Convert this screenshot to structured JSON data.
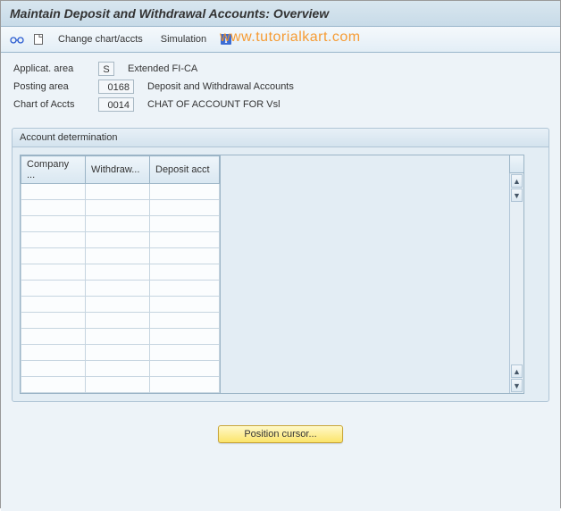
{
  "title": "Maintain Deposit and Withdrawal Accounts: Overview",
  "toolbar": {
    "change_chart_accts": "Change chart/accts",
    "simulation": "Simulation"
  },
  "watermark": "www.tutorialkart.com",
  "form": {
    "applicat_area": {
      "label": "Applicat. area",
      "value": "S",
      "desc": "Extended FI-CA"
    },
    "posting_area": {
      "label": "Posting area",
      "value": "0168",
      "desc": "Deposit and Withdrawal Accounts"
    },
    "chart_of_accts": {
      "label": "Chart of Accts",
      "value": "0014",
      "desc": "CHAT OF ACCOUNT FOR Vsl"
    }
  },
  "panel": {
    "title": "Account determination",
    "columns": [
      "Company ...",
      "Withdraw...",
      "Deposit acct"
    ],
    "rows": 13
  },
  "footer": {
    "position_cursor": "Position cursor..."
  }
}
